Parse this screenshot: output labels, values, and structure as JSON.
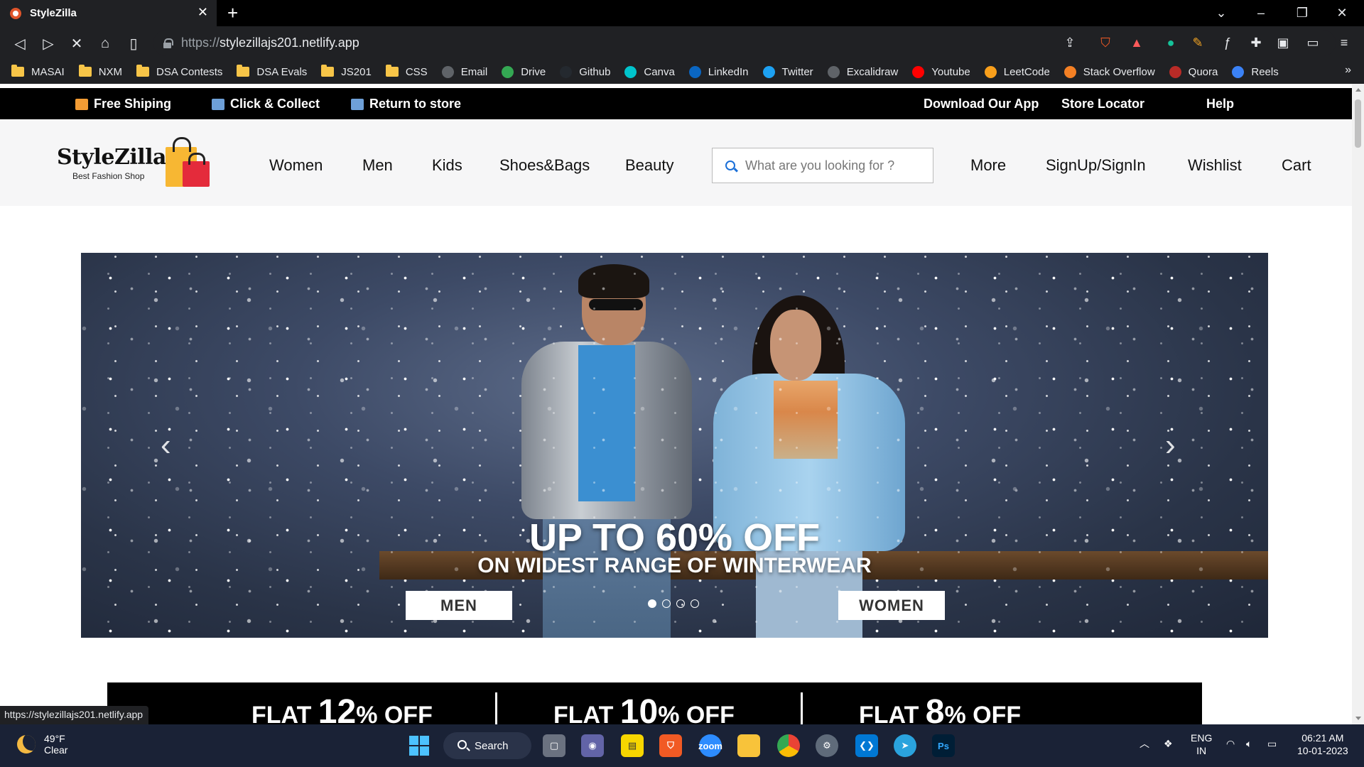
{
  "browser": {
    "tab_title": "StyleZilla",
    "url_scheme": "https://",
    "url_host": "stylezillajs201.netlify.app",
    "status_url": "https://stylezillajs201.netlify.app",
    "bookmarks": [
      {
        "label": "MASAI",
        "icon": "folder-icon"
      },
      {
        "label": "NXM",
        "icon": "folder-icon"
      },
      {
        "label": "DSA Contests",
        "icon": "folder-icon"
      },
      {
        "label": "DSA Evals",
        "icon": "folder-icon"
      },
      {
        "label": "JS201",
        "icon": "folder-icon"
      },
      {
        "label": "CSS",
        "icon": "folder-icon"
      },
      {
        "label": "Email",
        "icon": "globe-icon"
      },
      {
        "label": "Drive",
        "icon": "drive-icon"
      },
      {
        "label": "Github",
        "icon": "github-icon"
      },
      {
        "label": "Canva",
        "icon": "canva-icon"
      },
      {
        "label": "LinkedIn",
        "icon": "linkedin-icon"
      },
      {
        "label": "Twitter",
        "icon": "twitter-icon"
      },
      {
        "label": "Excalidraw",
        "icon": "globe-icon"
      },
      {
        "label": "Youtube",
        "icon": "youtube-icon"
      },
      {
        "label": "LeetCode",
        "icon": "leetcode-icon"
      },
      {
        "label": "Stack Overflow",
        "icon": "stackoverflow-icon"
      },
      {
        "label": "Quora",
        "icon": "quora-icon"
      },
      {
        "label": "Reels",
        "icon": "download-icon"
      }
    ]
  },
  "site": {
    "topbar": {
      "free_shipping": "Free Shiping",
      "click_collect": "Click & Collect",
      "return_store": "Return to store",
      "download_app": "Download Our App",
      "store_locator": "Store Locator",
      "help": "Help"
    },
    "logo": {
      "name": "StyleZilla",
      "tagline": "Best Fashion Shop"
    },
    "nav": {
      "women": "Women",
      "men": "Men",
      "kids": "Kids",
      "shoes_bags": "Shoes&Bags",
      "beauty": "Beauty",
      "more": "More",
      "signup": "SignUp/SignIn",
      "wishlist": "Wishlist",
      "cart": "Cart"
    },
    "search": {
      "placeholder": "What are you looking for ?"
    },
    "banner": {
      "headline": "UP TO 60% OFF",
      "subheadline": "ON WIDEST RANGE OF WINTERWEAR",
      "men_button": "MEN",
      "women_button": "WOMEN",
      "slide_count": 4,
      "active_slide": 1
    },
    "offers": [
      {
        "prefix": "FLAT ",
        "value": "12",
        "suffix": "% OFF"
      },
      {
        "prefix": "FLAT ",
        "value": "10",
        "suffix": "% OFF"
      },
      {
        "prefix": "FLAT ",
        "value": "8",
        "suffix": "% OFF"
      }
    ]
  },
  "taskbar": {
    "temperature": "49°F",
    "condition": "Clear",
    "search_label": "Search",
    "lang_top": "ENG",
    "lang_bottom": "IN",
    "time": "06:21 AM",
    "date": "10-01-2023"
  }
}
